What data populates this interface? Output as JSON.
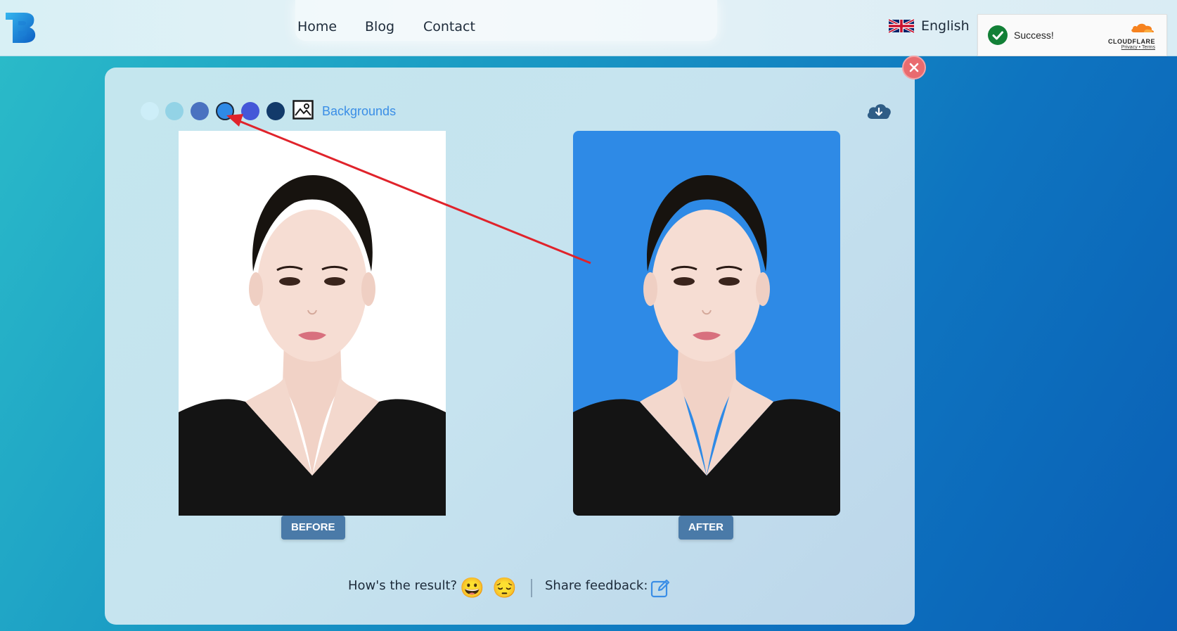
{
  "header": {
    "nav": [
      {
        "label": "Home"
      },
      {
        "label": "Blog"
      },
      {
        "label": "Contact"
      }
    ],
    "language": {
      "label": "English",
      "icon": "uk-flag-icon"
    }
  },
  "cloudflare": {
    "status": "Success!",
    "brand": "CLOUDFLARE",
    "privacy": "Privacy",
    "separator": "•",
    "terms": "Terms"
  },
  "editor": {
    "swatches": [
      {
        "color": "#cdeef8",
        "selected": false
      },
      {
        "color": "#93d3e6",
        "selected": false
      },
      {
        "color": "#4a72c0",
        "selected": false
      },
      {
        "color": "#2e8ae6",
        "selected": true
      },
      {
        "color": "#4457d8",
        "selected": false
      },
      {
        "color": "#123a6a",
        "selected": false
      }
    ],
    "backgrounds_label": "Backgrounds",
    "before_label": "BEFORE",
    "after_label": "AFTER",
    "after_bg": "#2e8ae6"
  },
  "feedback": {
    "question": "How's the result?",
    "happy_emoji": "😀",
    "sad_emoji": "😔",
    "share_label": "Share feedback:"
  },
  "colors": {
    "accent": "#3a8ee6",
    "close": "#e96b6f",
    "tag": "#4a7aa8"
  }
}
